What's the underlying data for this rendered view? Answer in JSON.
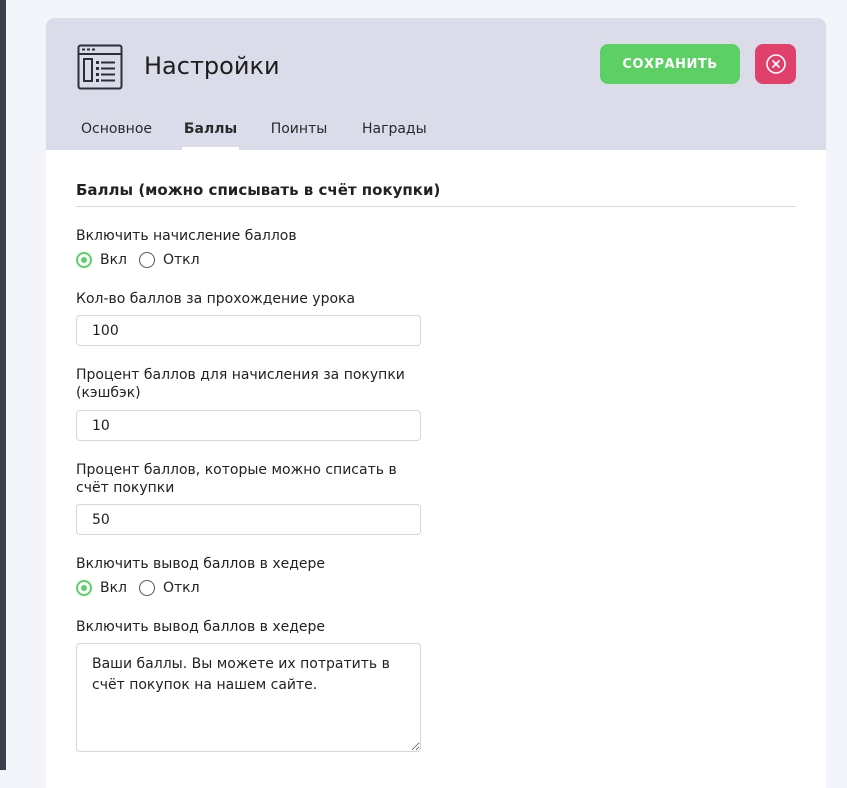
{
  "header": {
    "title": "Настройки",
    "icon": "settings-form-icon",
    "save_label": "СОХРАНИТЬ",
    "close_icon": "close-circle-icon"
  },
  "tabs": [
    {
      "label": "Основное",
      "active": false
    },
    {
      "label": "Баллы",
      "active": true
    },
    {
      "label": "Поинты",
      "active": false
    },
    {
      "label": "Награды",
      "active": false
    }
  ],
  "section": {
    "title": "Баллы (можно списывать в счёт покупки)"
  },
  "fields": {
    "enable_points": {
      "label": "Включить начисление баллов",
      "on_label": "Вкл",
      "off_label": "Откл",
      "value": "on"
    },
    "lesson_points": {
      "label": "Кол-во баллов за прохождение урока",
      "value": "100"
    },
    "cashback_percent": {
      "label": "Процент баллов для начисления за покупки (кэшбэк)",
      "value": "10"
    },
    "writeoff_percent": {
      "label": "Процент баллов, которые можно списать в счёт покупки",
      "value": "50"
    },
    "header_display": {
      "label": "Включить вывод баллов в хедере",
      "on_label": "Вкл",
      "off_label": "Откл",
      "value": "on"
    },
    "header_text": {
      "label": "Включить вывод баллов в хедере",
      "value": "Ваши баллы. Вы можете их потратить в счёт покупок на нашем сайте."
    }
  },
  "colors": {
    "accent_green": "#5cd065",
    "danger_red": "#e0416b",
    "header_bg": "#dadcea"
  }
}
